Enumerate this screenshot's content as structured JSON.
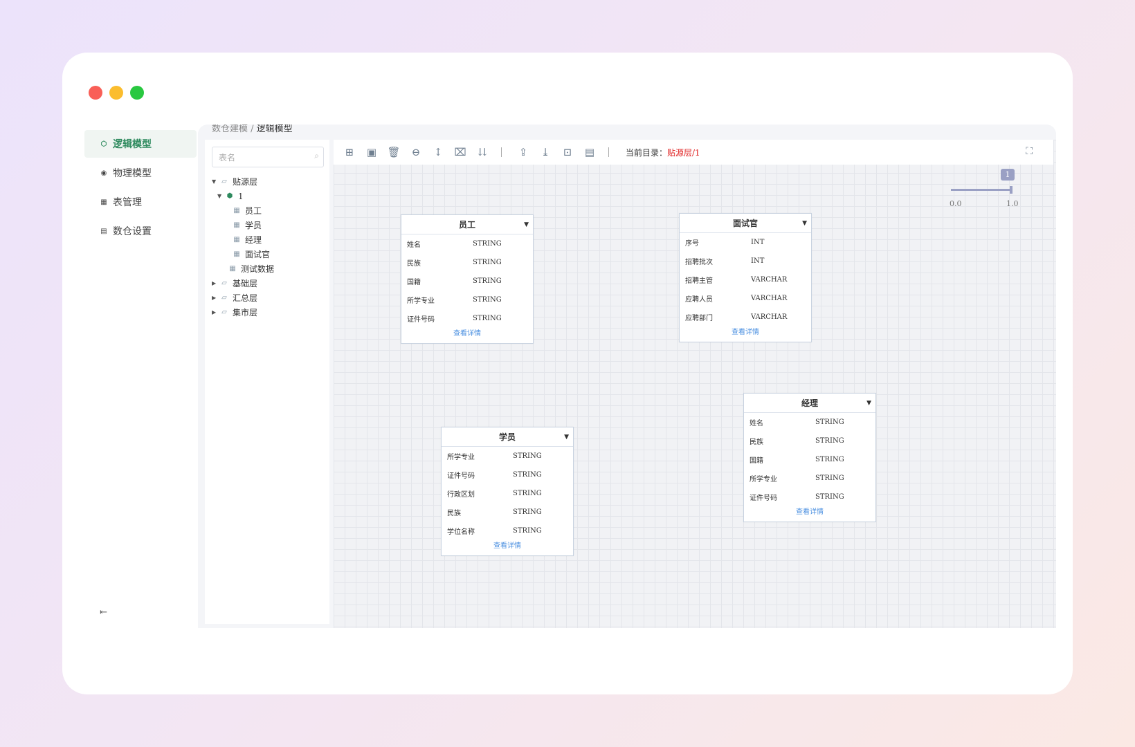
{
  "sidebar": {
    "items": [
      {
        "label": "逻辑模型",
        "icon": "cube-icon",
        "active": true
      },
      {
        "label": "物理模型",
        "icon": "disc-icon",
        "active": false
      },
      {
        "label": "表管理",
        "icon": "table-icon",
        "active": false
      },
      {
        "label": "数仓设置",
        "icon": "grid-icon",
        "active": false
      }
    ],
    "collapse_icon": "collapse-icon"
  },
  "breadcrumb": {
    "parent": "数仓建模",
    "sep": " / ",
    "current": "逻辑模型"
  },
  "tree": {
    "search_placeholder": "表名",
    "nodes": [
      {
        "label": "贴源层",
        "level": 0,
        "expanded": true,
        "icon": "layer-icon"
      },
      {
        "label": "1",
        "level": 1,
        "expanded": true,
        "icon": "cube-icon"
      },
      {
        "label": "员工",
        "level": 2,
        "icon": "table-icon"
      },
      {
        "label": "学员",
        "level": 2,
        "icon": "table-icon"
      },
      {
        "label": "经理",
        "level": 2,
        "icon": "table-icon"
      },
      {
        "label": "面试官",
        "level": 2,
        "icon": "table-icon"
      },
      {
        "label": "测试数据",
        "level": 1,
        "icon": "table-icon"
      },
      {
        "label": "基础层",
        "level": 0,
        "expanded": false,
        "icon": "layer-icon"
      },
      {
        "label": "汇总层",
        "level": 0,
        "expanded": false,
        "icon": "layer-icon"
      },
      {
        "label": "集市层",
        "level": 0,
        "expanded": false,
        "icon": "layer-icon"
      }
    ]
  },
  "toolbar": {
    "dir_label": "当前目录：",
    "dir_value": "贴源层/1"
  },
  "slider": {
    "badge": "1",
    "min_label": "0.0",
    "max_label": "1.0",
    "value": 1.0
  },
  "entities": {
    "yuangong": {
      "title": "员工",
      "fields": [
        {
          "name": "姓名",
          "type": "STRING"
        },
        {
          "name": "民族",
          "type": "STRING"
        },
        {
          "name": "国籍",
          "type": "STRING"
        },
        {
          "name": "所学专业",
          "type": "STRING"
        },
        {
          "name": "证件号码",
          "type": "STRING"
        }
      ],
      "link": "查看详情"
    },
    "mianshiguan": {
      "title": "面试官",
      "fields": [
        {
          "name": "序号",
          "type": "INT"
        },
        {
          "name": "招聘批次",
          "type": "INT"
        },
        {
          "name": "招聘主管",
          "type": "VARCHAR"
        },
        {
          "name": "应聘人员",
          "type": "VARCHAR"
        },
        {
          "name": "应聘部门",
          "type": "VARCHAR"
        }
      ],
      "link": "查看详情"
    },
    "xueyuan": {
      "title": "学员",
      "fields": [
        {
          "name": "所学专业",
          "type": "STRING"
        },
        {
          "name": "证件号码",
          "type": "STRING"
        },
        {
          "name": "行政区划",
          "type": "STRING"
        },
        {
          "name": "民族",
          "type": "STRING"
        },
        {
          "name": "学位名称",
          "type": "STRING"
        }
      ],
      "link": "查看详情"
    },
    "jingli": {
      "title": "经理",
      "fields": [
        {
          "name": "姓名",
          "type": "STRING"
        },
        {
          "name": "民族",
          "type": "STRING"
        },
        {
          "name": "国籍",
          "type": "STRING"
        },
        {
          "name": "所学专业",
          "type": "STRING"
        },
        {
          "name": "证件号码",
          "type": "STRING"
        }
      ],
      "link": "查看详情"
    }
  },
  "colors": {
    "accent": "#2e8a5e",
    "dir_value": "#e02020",
    "link": "#4a8fe0"
  }
}
